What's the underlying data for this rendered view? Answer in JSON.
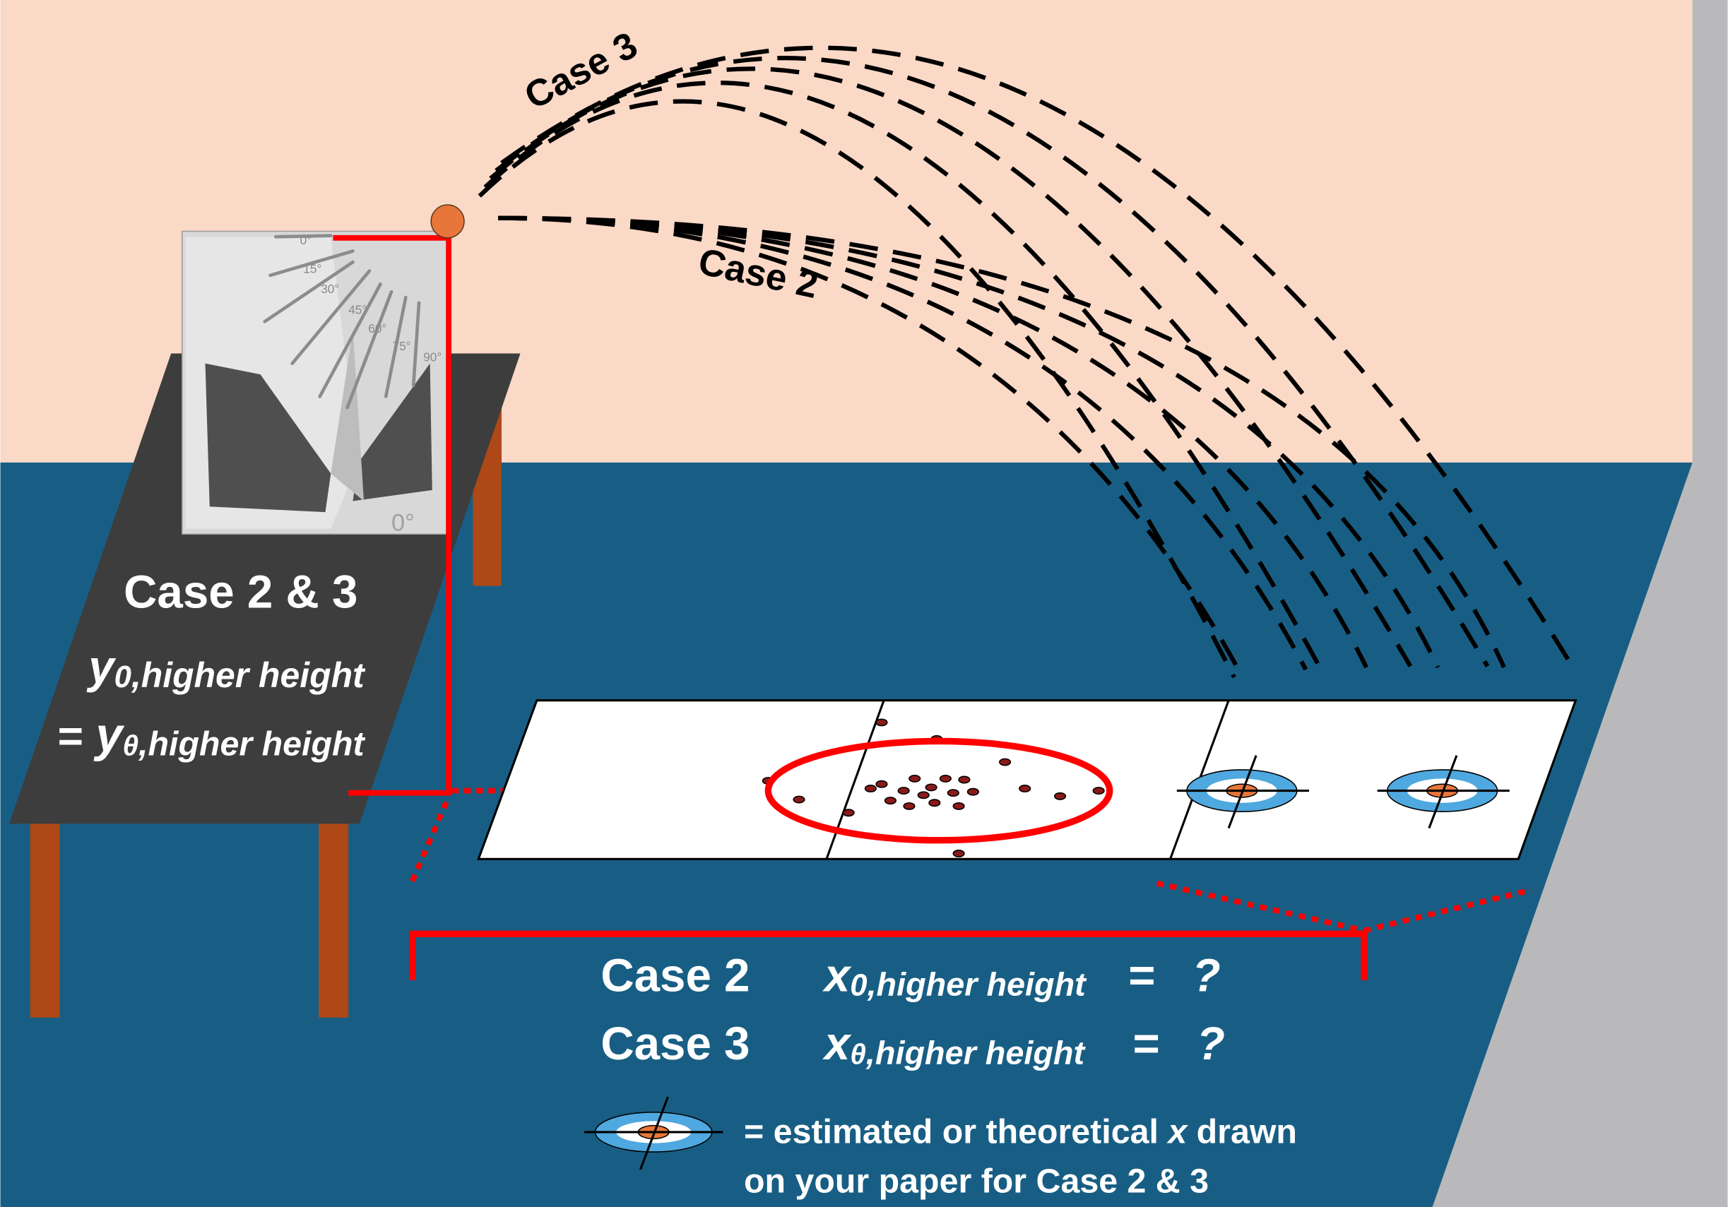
{
  "colors": {
    "wall": "#fbd9c7",
    "floor": "#185e84",
    "side_strip": "#b9b9bb",
    "table_top": "#3d3d3d",
    "table_leg": "#ae4816",
    "measure_line": "#ff0000",
    "ball": "#e8763a",
    "target_blue": "#4fa8df",
    "target_center": "#e8763a"
  },
  "trajectories": {
    "case3_label": "Case 3",
    "case2_label": "Case 2"
  },
  "launcher": {
    "angle_marks": [
      "0°",
      "15°",
      "30°",
      "45°",
      "60°",
      "75°",
      "90°"
    ],
    "bottom_mark": "0°"
  },
  "table_label": {
    "title": "Case 2 & 3",
    "y0_symbol": "y",
    "y0_sub": "0",
    "y0_suffix": ",higher height",
    "eq_prefix": "= ",
    "ytheta_symbol": "y",
    "ytheta_sub": "θ",
    "ytheta_suffix": ",higher height"
  },
  "results": {
    "case2_label": "Case 2",
    "case3_label": "Case 3",
    "x0_symbol": "x",
    "x0_sub": "0",
    "x0_suffix": ",higher height",
    "xtheta_symbol": "x",
    "xtheta_sub": "θ",
    "xtheta_suffix": ",higher height",
    "equals": "=",
    "unknown": "?"
  },
  "legend": {
    "line1_prefix": "= estimated or theoretical ",
    "line1_var": "x",
    "line1_suffix": " drawn",
    "line2": "on your paper for Case 2 & 3",
    "icon": "target-icon"
  }
}
